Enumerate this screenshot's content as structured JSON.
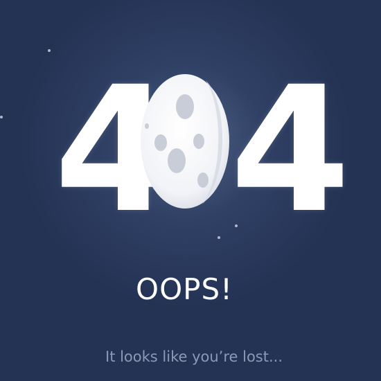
{
  "error": {
    "code_left_digit": "4",
    "code_right_digit": "4",
    "title": "OOPS!",
    "message": "It looks like you’re lost..."
  },
  "icons": {
    "center_zero": "moon-icon"
  },
  "colors": {
    "background": "#243354",
    "digit": "#ffffff",
    "subtitle": "#8c98b8",
    "moon": "#f4f5f8",
    "crater": "#c9cdd7"
  }
}
